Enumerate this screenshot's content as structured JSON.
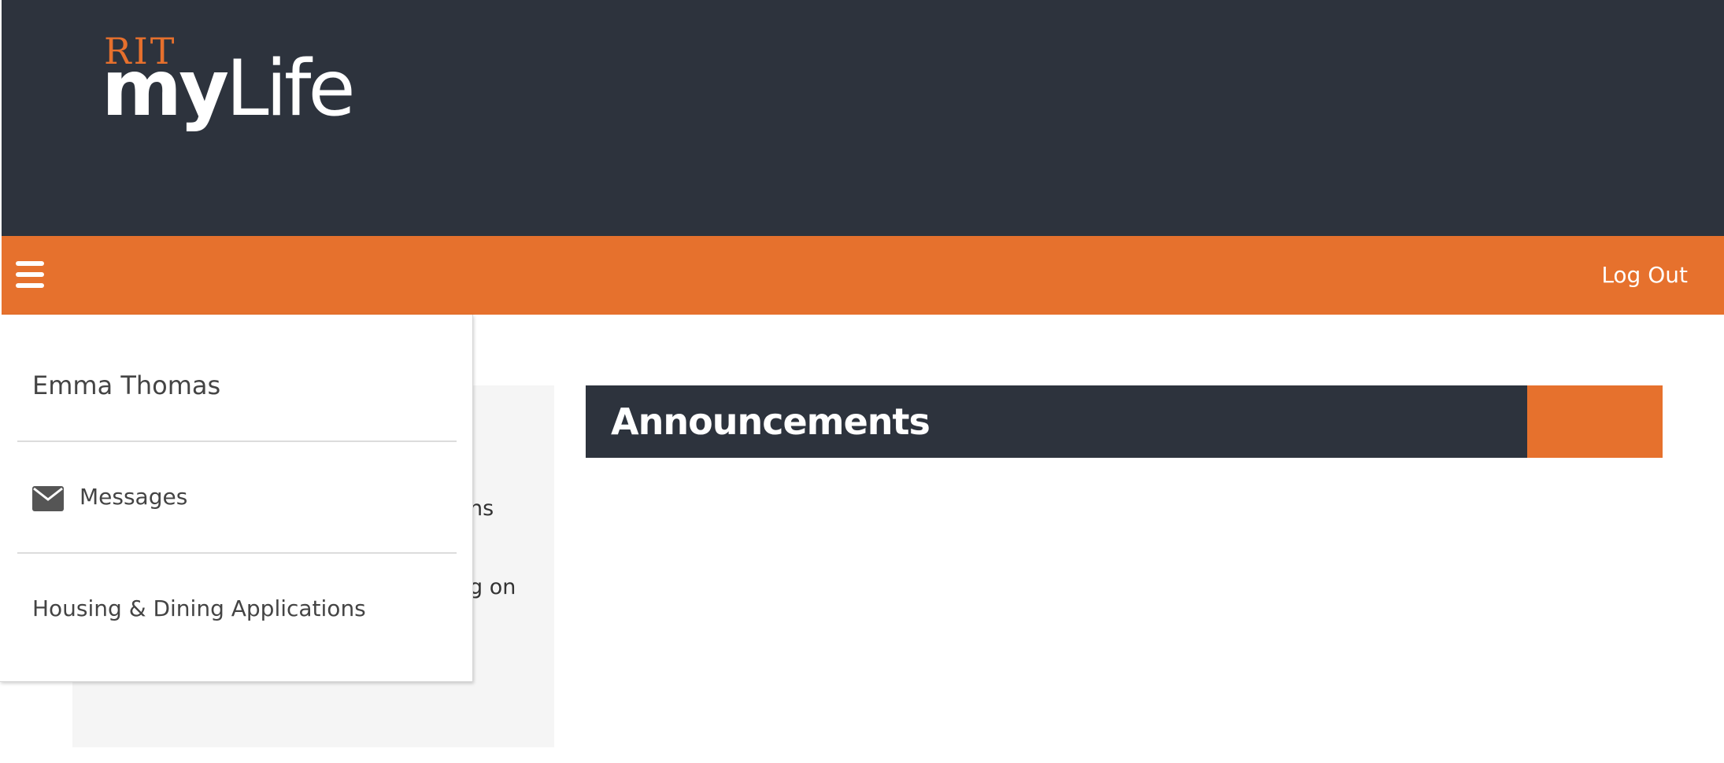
{
  "header": {
    "logo_rit": "RIT",
    "logo_my": "my",
    "logo_life": "Life"
  },
  "navbar": {
    "menu_icon": "hamburger-menu-icon",
    "logout_label": "Log Out"
  },
  "drawer": {
    "user_name": "Emma Thomas",
    "items": [
      {
        "label": "Messages",
        "icon": "envelope-icon"
      },
      {
        "label": "Housing & Dining Applications"
      }
    ]
  },
  "background_panel": {
    "partial_texts": [
      "ns",
      "g on"
    ]
  },
  "announcements": {
    "title": "Announcements"
  },
  "colors": {
    "header_bg": "#2d333d",
    "accent_orange": "#e6712d",
    "panel_gray": "#f5f5f5"
  }
}
